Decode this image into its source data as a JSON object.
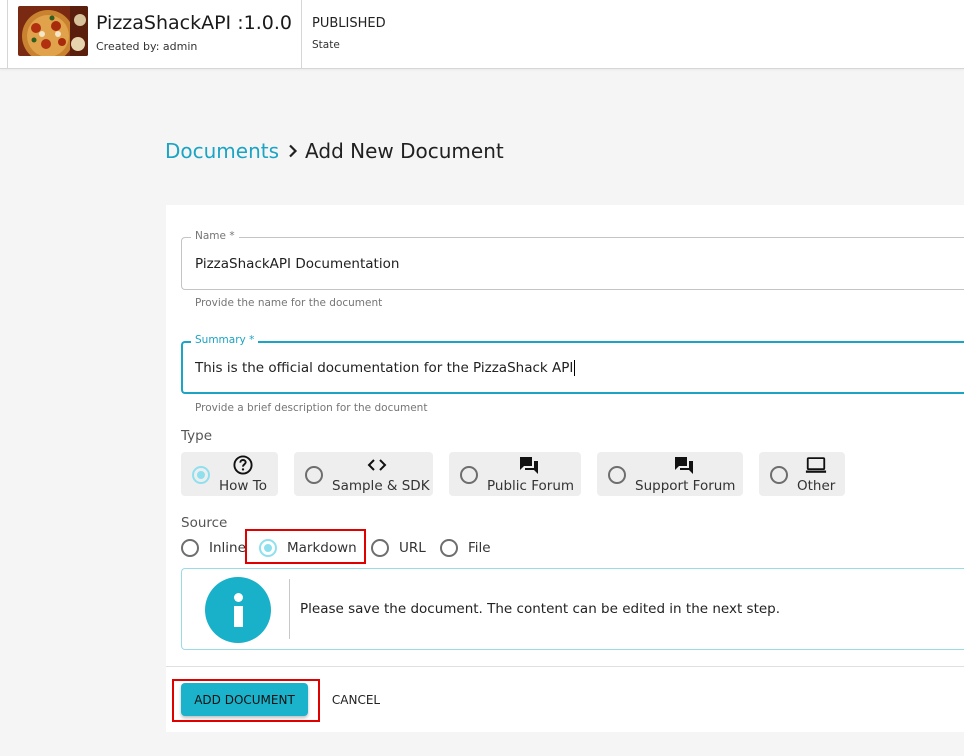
{
  "header": {
    "api_title": "PizzaShackAPI :1.0.0",
    "created_by": "Created by: admin",
    "state_value": "PUBLISHED",
    "state_label": "State"
  },
  "breadcrumb": {
    "link": "Documents",
    "current": "Add New Document"
  },
  "form": {
    "name": {
      "label": "Name *",
      "value": "PizzaShackAPI Documentation",
      "helper": "Provide the name for the document"
    },
    "summary": {
      "label": "Summary *",
      "value": "This is the official documentation for the PizzaShack API",
      "helper": "Provide a brief description for the document"
    },
    "type": {
      "label": "Type",
      "selected": "How To",
      "options": [
        {
          "label": "How To",
          "icon": "help-circle-icon"
        },
        {
          "label": "Sample & SDK",
          "icon": "code-icon"
        },
        {
          "label": "Public Forum",
          "icon": "forum-icon"
        },
        {
          "label": "Support Forum",
          "icon": "forum-icon"
        },
        {
          "label": "Other",
          "icon": "laptop-icon"
        }
      ]
    },
    "source": {
      "label": "Source",
      "selected": "Markdown",
      "options": [
        "Inline",
        "Markdown",
        "URL",
        "File"
      ]
    },
    "info_message": "Please save the document. The content can be edited in the next step."
  },
  "actions": {
    "add_label": "ADD DOCUMENT",
    "cancel_label": "CANCEL"
  },
  "colors": {
    "accent": "#1ba4c4",
    "button": "#1bb3cb",
    "radio_checked": "#8fe0ef",
    "highlight": "#e00000"
  }
}
